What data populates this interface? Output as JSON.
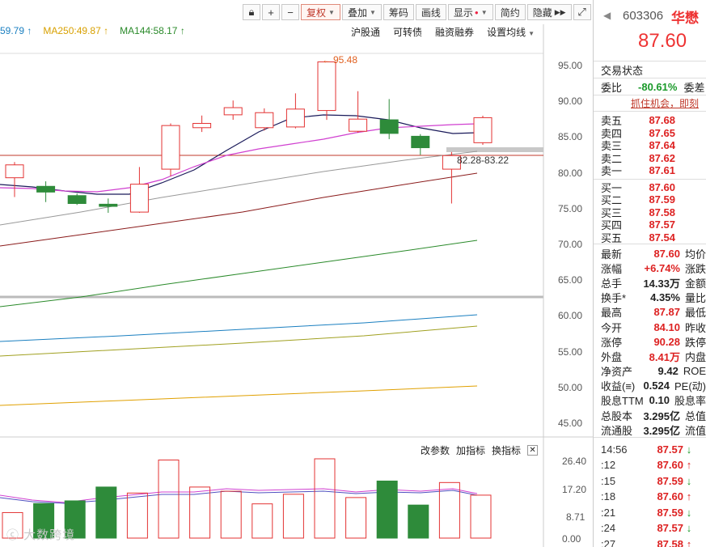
{
  "toolbar": {
    "lock_icon": "lock-icon",
    "plus": "+",
    "minus": "−",
    "fuquan": "复权",
    "diejia": "叠加",
    "chouma": "筹码",
    "huaxian": "画线",
    "xianshi": "显示",
    "jianyue": "简约",
    "yincang": "隐藏",
    "fullscreen_icon": "expand-icon"
  },
  "ma_legend": {
    "ma_partial": "59.79 ↑",
    "ma250": "MA250:49.87 ↑",
    "ma144": "MA144:58.17 ↑"
  },
  "sub_tools": [
    "沪股通",
    "可转债",
    "融资融券",
    "设置均线"
  ],
  "price_axis": [
    "95.00",
    "90.00",
    "85.00",
    "80.00",
    "75.00",
    "70.00",
    "65.00",
    "60.00",
    "55.00",
    "50.00",
    "45.00"
  ],
  "annotations": {
    "high": "95.48",
    "range": "82.28-83.22"
  },
  "vol_tools": [
    "改参数",
    "加指标",
    "换指标"
  ],
  "vol_axis": [
    "26.40",
    "17.20",
    "8.71",
    "0.00"
  ],
  "watermark": "大数跨境",
  "colors": {
    "up": "#e33333",
    "down": "#2e8b3a",
    "ma_pink": "#d040d0",
    "ma_navy": "#1a1a5a"
  },
  "chart_data": {
    "type": "candlestick",
    "ylim": [
      43,
      99
    ],
    "candles": [
      {
        "open": 79.2,
        "close": 81.0,
        "high": 81.4,
        "low": 76.5
      },
      {
        "open": 78.0,
        "close": 77.2,
        "high": 78.7,
        "low": 75.8
      },
      {
        "open": 76.7,
        "close": 75.6,
        "high": 77.0,
        "low": 75.4
      },
      {
        "open": 75.5,
        "close": 75.2,
        "high": 76.3,
        "low": 74.3
      },
      {
        "open": 74.4,
        "close": 78.3,
        "high": 80.7,
        "low": 74.3
      },
      {
        "open": 80.4,
        "close": 86.5,
        "high": 86.8,
        "low": 79.4
      },
      {
        "open": 86.2,
        "close": 86.8,
        "high": 87.9,
        "low": 85.6
      },
      {
        "open": 88.0,
        "close": 89.0,
        "high": 90.0,
        "low": 87.3
      },
      {
        "open": 86.2,
        "close": 88.3,
        "high": 88.9,
        "low": 85.8
      },
      {
        "open": 86.3,
        "close": 88.8,
        "high": 91.0,
        "low": 86.1
      },
      {
        "open": 88.6,
        "close": 95.4,
        "high": 95.48,
        "low": 87.3
      },
      {
        "open": 85.7,
        "close": 87.4,
        "high": 91.3,
        "low": 85.5
      },
      {
        "open": 87.3,
        "close": 85.4,
        "high": 90.2,
        "low": 84.6
      },
      {
        "open": 85.0,
        "close": 83.4,
        "high": 85.3,
        "low": 82.4
      },
      {
        "open": 80.4,
        "close": 82.3,
        "high": 82.8,
        "low": 75.6
      },
      {
        "open": 84.1,
        "close": 87.6,
        "high": 87.87,
        "low": 83.8
      }
    ],
    "volume": {
      "ylim": [
        0,
        30
      ],
      "values": [
        8.5,
        11.5,
        12.4,
        17.0,
        15.0,
        26.0,
        17.0,
        15.6,
        11.4,
        14.6,
        26.4,
        13.5,
        19.0,
        11.0,
        18.5,
        14.3
      ]
    }
  },
  "right_panel": {
    "code": "603306",
    "name": "华懋",
    "price": "87.60",
    "trade_status": "交易状态",
    "weibi_label": "委比",
    "weibi_value": "-80.61%",
    "weicha_label": "委差",
    "promo": "抓住机会，即刻",
    "sells": [
      {
        "label": "卖五",
        "price": "87.68"
      },
      {
        "label": "卖四",
        "price": "87.65"
      },
      {
        "label": "卖三",
        "price": "87.64"
      },
      {
        "label": "卖二",
        "price": "87.62"
      },
      {
        "label": "卖一",
        "price": "87.61"
      }
    ],
    "buys": [
      {
        "label": "买一",
        "price": "87.60"
      },
      {
        "label": "买二",
        "price": "87.59"
      },
      {
        "label": "买三",
        "price": "87.58"
      },
      {
        "label": "买四",
        "price": "87.57"
      },
      {
        "label": "买五",
        "price": "87.54"
      }
    ],
    "stats": [
      {
        "label": "最新",
        "value": "87.60",
        "cls": "red bold",
        "label2": "均价"
      },
      {
        "label": "涨幅",
        "value": "+6.74%",
        "cls": "red bold",
        "label2": "涨跌"
      },
      {
        "label": "总手",
        "value": "14.33万",
        "cls": "bold",
        "label2": "金额"
      },
      {
        "label": "换手*",
        "value": "4.35%",
        "cls": "bold",
        "label2": "量比"
      },
      {
        "label": "最高",
        "value": "87.87",
        "cls": "red bold",
        "label2": "最低"
      },
      {
        "label": "今开",
        "value": "84.10",
        "cls": "red bold",
        "label2": "昨收"
      },
      {
        "label": "涨停",
        "value": "90.28",
        "cls": "red bold",
        "label2": "跌停"
      },
      {
        "label": "外盘",
        "value": "8.41万",
        "cls": "red bold",
        "label2": "内盘"
      },
      {
        "label": "净资产",
        "value": "9.42",
        "cls": "bold",
        "label2": "ROE"
      },
      {
        "label": "收益(≡)",
        "value": "0.524",
        "cls": "bold",
        "label2": "PE(动)"
      },
      {
        "label": "股息TTM",
        "value": "0.10",
        "cls": "bold",
        "label2": "股息率"
      },
      {
        "label": "总股本",
        "value": "3.295亿",
        "cls": "bold",
        "label2": "总值"
      },
      {
        "label": "流通股",
        "value": "3.295亿",
        "cls": "bold",
        "label2": "流值"
      }
    ],
    "ticks": [
      {
        "time": "14:56",
        "price": "87.57",
        "dir": "↓",
        "up": false
      },
      {
        "time": ":12",
        "price": "87.60",
        "dir": "↑",
        "up": true
      },
      {
        "time": ":15",
        "price": "87.59",
        "dir": "↓",
        "up": false
      },
      {
        "time": ":18",
        "price": "87.60",
        "dir": "↑",
        "up": true
      },
      {
        "time": ":21",
        "price": "87.59",
        "dir": "↓",
        "up": false
      },
      {
        "time": ":24",
        "price": "87.57",
        "dir": "↓",
        "up": false
      },
      {
        "time": ":27",
        "price": "87.58",
        "dir": "↑",
        "up": true
      }
    ]
  }
}
